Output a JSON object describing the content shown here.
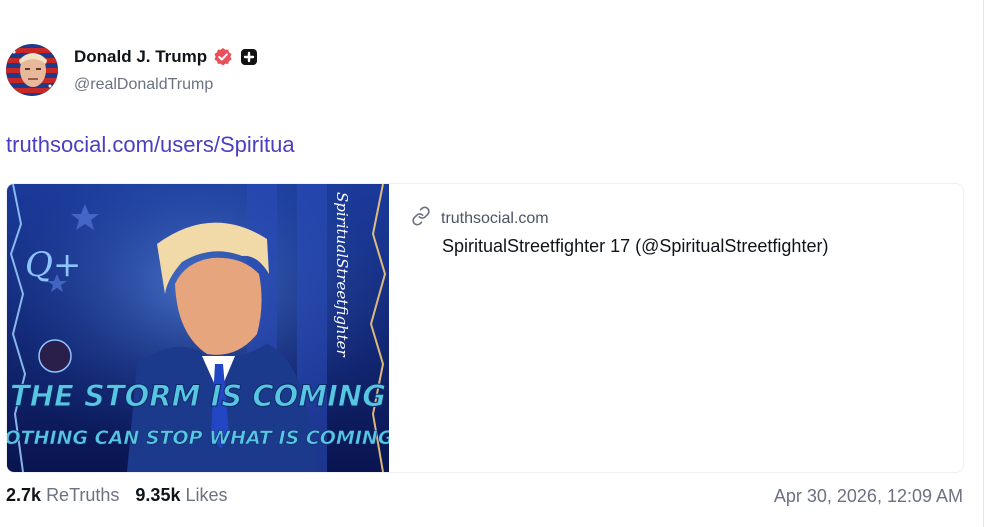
{
  "author": {
    "name": "Donald J. Trump",
    "handle": "@realDonaldTrump"
  },
  "post": {
    "link_text": "truthsocial.com/users/Spiritua"
  },
  "card": {
    "domain": "truthsocial.com",
    "title": "SpiritualStreetfighter 17 (@SpiritualStreetfighter)",
    "image": {
      "headline": "THE STORM IS COMING",
      "subline": "NOTHING CAN STOP WHAT IS COMING",
      "signature": "SpiritualStreetfighter",
      "letter": "Q+"
    }
  },
  "stats": {
    "retruths_count": "2.7k",
    "retruths_label": "ReTruths",
    "likes_count": "9.35k",
    "likes_label": "Likes"
  },
  "timestamp": "Apr 30, 2026, 12:09 AM",
  "colors": {
    "link": "#4c3ec2",
    "verified": "#e8505b",
    "muted": "#6b7280"
  },
  "icons": {
    "verified": "verified-badge-icon",
    "plus": "plus-badge-icon",
    "link": "link-icon"
  }
}
